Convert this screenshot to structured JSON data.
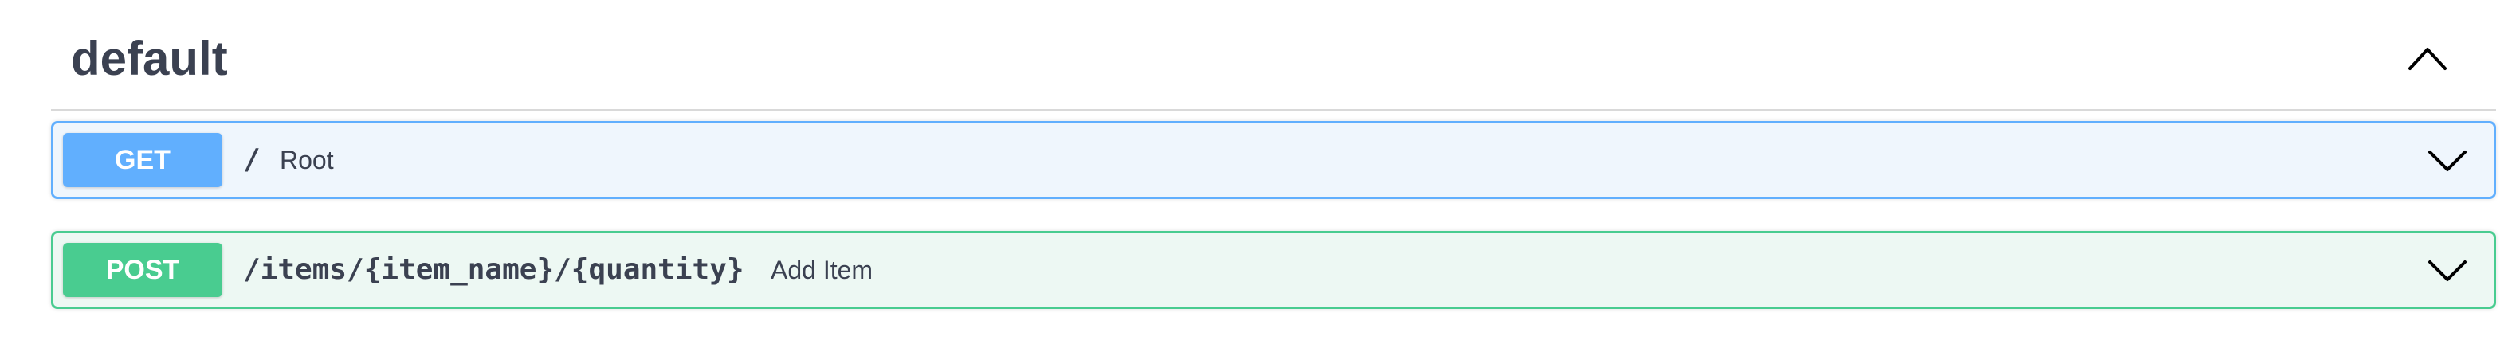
{
  "tag": {
    "name": "default",
    "toggle_icon": "chevron-up-icon"
  },
  "operations": [
    {
      "method": "GET",
      "path": "/",
      "summary": "Root",
      "color": "#61affe",
      "expand_icon": "chevron-down-icon"
    },
    {
      "method": "POST",
      "path": "/items/{item_name}/{quantity}",
      "summary": "Add Item",
      "color": "#49cc90",
      "expand_icon": "chevron-down-icon"
    }
  ]
}
